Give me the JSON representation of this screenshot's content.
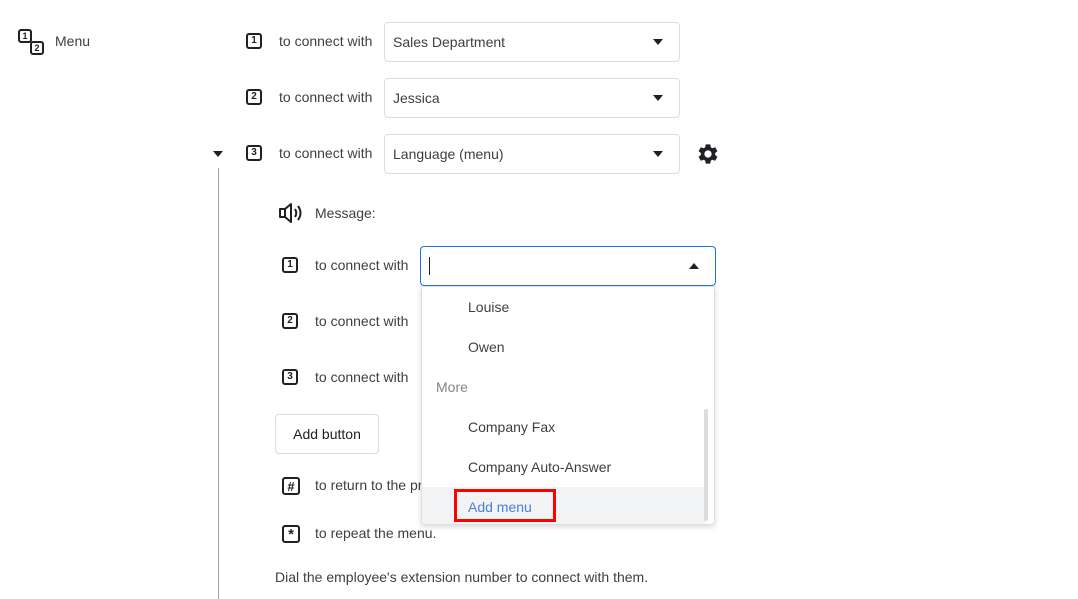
{
  "section": {
    "icon": "numbered-menu-icon",
    "label": "Menu",
    "icon_digits": [
      "1",
      "2"
    ]
  },
  "top_rows": [
    {
      "number": "1",
      "text": "to connect with",
      "value": "Sales Department"
    },
    {
      "number": "2",
      "text": "to connect with",
      "value": "Jessica"
    },
    {
      "number": "3",
      "text": "to connect with",
      "value": "Language (menu)"
    }
  ],
  "submenu": {
    "message_label": "Message:",
    "rows": [
      {
        "number": "1",
        "text": "to connect with",
        "value": ""
      },
      {
        "number": "2",
        "text": "to connect with"
      },
      {
        "number": "3",
        "text": "to connect with"
      }
    ],
    "add_button": "Add button",
    "hash_key": "#",
    "hash_text": "to return to the pr",
    "star_key": "*",
    "star_text": "to repeat the menu.",
    "footer": "Dial the employee's extension number to connect with them."
  },
  "dropdown": {
    "items": [
      {
        "label": "Louise"
      },
      {
        "label": "Owen"
      }
    ],
    "group_label": "More",
    "group_items": [
      {
        "label": "Company Fax"
      },
      {
        "label": "Company Auto-Answer"
      },
      {
        "label": "Add menu"
      }
    ]
  },
  "colors": {
    "link": "#1a73e8",
    "highlight_border": "#ff0000",
    "focus_border": "#1a73e8"
  }
}
